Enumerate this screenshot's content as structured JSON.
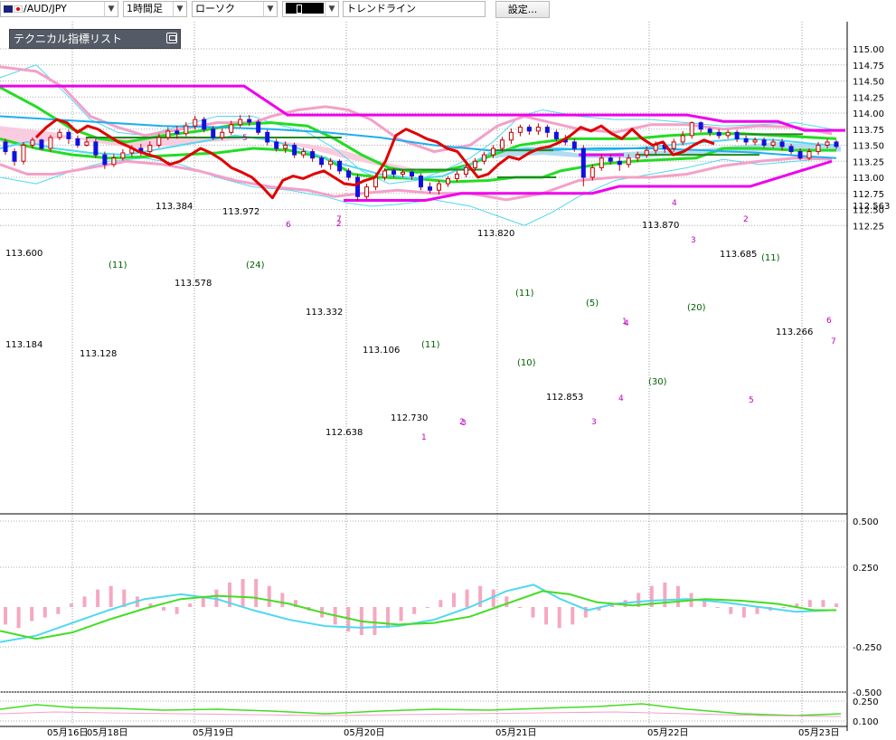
{
  "toolbar": {
    "symbol": "AUD/JPY",
    "timeframe": "1時間足",
    "chart_type": "ローソク",
    "tool": "トレンドライン",
    "settings_label": "設定...",
    "swatch_color": "#000000"
  },
  "indicator_list_title": "テクニカル指標リスト",
  "colors": {
    "bull": "#ffffff",
    "bear": "#1010e0",
    "wick": "#c00000",
    "rsi_line": "#e00000",
    "trendline": "#ee00ee",
    "green_band": "#22dd22",
    "pink_band": "#f4a0c8",
    "cyan_band": "#50d8f0",
    "ma_blue": "#1eaef0",
    "cloud_pink": "#f8c8dc",
    "cloud_blue": "#a8d8f0",
    "macd_hist": "#f6a8c0",
    "level_line": "#228822"
  },
  "chart_data": {
    "type": "candlestick",
    "title": "",
    "price_axis_ticks": [
      "115.00",
      "114.75",
      "114.50",
      "114.25",
      "114.00",
      "113.75",
      "113.50",
      "113.25",
      "113.00",
      "112.75",
      "112.50",
      "112.25"
    ],
    "current_price_label": "112.563",
    "ylim": [
      112.2,
      115.1
    ],
    "x_date_labels": [
      "05月16日",
      "05月18日",
      "05月19日",
      "05月20日",
      "05月21日",
      "05月22日",
      "05月23日"
    ],
    "price_annotations": [
      "113.600",
      "113.184",
      "113.128",
      "113.384",
      "113.578",
      "113.972",
      "113.332",
      "113.106",
      "112.638",
      "112.730",
      "113.820",
      "112.853",
      "113.870",
      "113.685",
      "113.266"
    ],
    "period_labels": [
      "(11)",
      "(24)",
      "(11)",
      "(10)",
      "(11)",
      "(5)",
      "(20)",
      "(30)",
      "(11)"
    ],
    "trendline_numbers": [
      "5",
      "6",
      "7",
      "4",
      "3",
      "2",
      "1",
      "2",
      "3",
      "4",
      "1",
      "5",
      "6",
      "7",
      "2",
      "3",
      "4"
    ],
    "macd_axis_ticks": [
      "0.500",
      "0.250",
      "-0.250",
      "-0.500"
    ],
    "lower_axis_ticks": [
      "0.250",
      "0.100"
    ],
    "candles": [
      [
        113.55,
        113.4,
        113.6,
        113.35
      ],
      [
        113.4,
        113.25,
        113.45,
        113.18
      ],
      [
        113.25,
        113.5,
        113.55,
        113.2
      ],
      [
        113.5,
        113.58,
        113.62,
        113.45
      ],
      [
        113.58,
        113.45,
        113.6,
        113.42
      ],
      [
        113.45,
        113.62,
        113.66,
        113.4
      ],
      [
        113.62,
        113.7,
        113.75,
        113.58
      ],
      [
        113.7,
        113.6,
        113.74,
        113.52
      ],
      [
        113.6,
        113.5,
        113.65,
        113.46
      ],
      [
        113.5,
        113.55,
        113.62,
        113.48
      ],
      [
        113.55,
        113.35,
        113.6,
        113.3
      ],
      [
        113.35,
        113.2,
        113.4,
        113.13
      ],
      [
        113.2,
        113.3,
        113.36,
        113.16
      ],
      [
        113.3,
        113.38,
        113.44,
        113.26
      ],
      [
        113.38,
        113.45,
        113.5,
        113.32
      ],
      [
        113.45,
        113.4,
        113.52,
        113.34
      ],
      [
        113.4,
        113.5,
        113.56,
        113.36
      ],
      [
        113.5,
        113.62,
        113.68,
        113.46
      ],
      [
        113.62,
        113.72,
        113.78,
        113.58
      ],
      [
        113.72,
        113.68,
        113.8,
        113.6
      ],
      [
        113.68,
        113.8,
        113.86,
        113.64
      ],
      [
        113.8,
        113.9,
        113.96,
        113.74
      ],
      [
        113.9,
        113.75,
        113.94,
        113.7
      ],
      [
        113.75,
        113.62,
        113.8,
        113.58
      ],
      [
        113.62,
        113.7,
        113.76,
        113.58
      ],
      [
        113.7,
        113.82,
        113.88,
        113.66
      ],
      [
        113.82,
        113.9,
        113.97,
        113.78
      ],
      [
        113.9,
        113.86,
        113.97,
        113.8
      ],
      [
        113.86,
        113.7,
        113.9,
        113.66
      ],
      [
        113.7,
        113.55,
        113.74,
        113.5
      ],
      [
        113.55,
        113.45,
        113.6,
        113.4
      ],
      [
        113.45,
        113.5,
        113.56,
        113.38
      ],
      [
        113.5,
        113.35,
        113.54,
        113.3
      ],
      [
        113.35,
        113.4,
        113.46,
        113.3
      ],
      [
        113.4,
        113.3,
        113.44,
        113.24
      ],
      [
        113.3,
        113.2,
        113.34,
        113.15
      ],
      [
        113.2,
        113.25,
        113.3,
        113.12
      ],
      [
        113.25,
        113.1,
        113.28,
        113.05
      ],
      [
        113.1,
        113.0,
        113.14,
        112.95
      ],
      [
        113.0,
        112.7,
        113.05,
        112.64
      ],
      [
        112.7,
        112.85,
        112.9,
        112.66
      ],
      [
        112.85,
        113.0,
        113.06,
        112.8
      ],
      [
        113.0,
        113.1,
        113.14,
        112.95
      ],
      [
        113.1,
        113.05,
        113.14,
        113.0
      ],
      [
        113.05,
        113.08,
        113.12,
        113.0
      ],
      [
        113.08,
        113.02,
        113.1,
        112.96
      ],
      [
        113.02,
        112.85,
        113.06,
        112.8
      ],
      [
        112.85,
        112.8,
        112.92,
        112.75
      ],
      [
        112.8,
        112.9,
        112.95,
        112.73
      ],
      [
        112.9,
        112.98,
        113.02,
        112.85
      ],
      [
        112.98,
        113.05,
        113.1,
        112.93
      ],
      [
        113.05,
        113.15,
        113.2,
        113.0
      ],
      [
        113.15,
        113.25,
        113.3,
        113.1
      ],
      [
        113.25,
        113.35,
        113.4,
        113.2
      ],
      [
        113.35,
        113.45,
        113.5,
        113.3
      ],
      [
        113.45,
        113.58,
        113.63,
        113.4
      ],
      [
        113.58,
        113.7,
        113.76,
        113.52
      ],
      [
        113.7,
        113.78,
        113.82,
        113.64
      ],
      [
        113.78,
        113.72,
        113.82,
        113.66
      ],
      [
        113.72,
        113.78,
        113.84,
        113.66
      ],
      [
        113.78,
        113.7,
        113.82,
        113.62
      ],
      [
        113.7,
        113.6,
        113.74,
        113.56
      ],
      [
        113.6,
        113.55,
        113.66,
        113.5
      ],
      [
        113.55,
        113.45,
        113.6,
        113.4
      ],
      [
        113.45,
        113.0,
        113.5,
        112.86
      ],
      [
        113.0,
        113.15,
        113.2,
        112.95
      ],
      [
        113.15,
        113.3,
        113.36,
        113.1
      ],
      [
        113.3,
        113.25,
        113.36,
        113.2
      ],
      [
        113.25,
        113.2,
        113.32,
        113.1
      ],
      [
        113.2,
        113.3,
        113.36,
        113.15
      ],
      [
        113.3,
        113.35,
        113.4,
        113.24
      ],
      [
        113.35,
        113.42,
        113.48,
        113.3
      ],
      [
        113.42,
        113.5,
        113.56,
        113.36
      ],
      [
        113.5,
        113.45,
        113.55,
        113.38
      ],
      [
        113.45,
        113.55,
        113.6,
        113.4
      ],
      [
        113.55,
        113.65,
        113.72,
        113.5
      ],
      [
        113.65,
        113.85,
        113.87,
        113.6
      ],
      [
        113.85,
        113.75,
        113.87,
        113.7
      ],
      [
        113.75,
        113.7,
        113.78,
        113.64
      ],
      [
        113.7,
        113.65,
        113.75,
        113.6
      ],
      [
        113.65,
        113.7,
        113.74,
        113.6
      ],
      [
        113.7,
        113.6,
        113.74,
        113.55
      ],
      [
        113.6,
        113.55,
        113.65,
        113.5
      ],
      [
        113.55,
        113.58,
        113.62,
        113.5
      ],
      [
        113.58,
        113.5,
        113.62,
        113.46
      ],
      [
        113.5,
        113.55,
        113.6,
        113.46
      ],
      [
        113.55,
        113.48,
        113.6,
        113.42
      ],
      [
        113.48,
        113.4,
        113.52,
        113.36
      ],
      [
        113.4,
        113.3,
        113.45,
        113.27
      ],
      [
        113.3,
        113.4,
        113.45,
        113.27
      ],
      [
        113.4,
        113.5,
        113.55,
        113.35
      ],
      [
        113.5,
        113.55,
        113.6,
        113.45
      ],
      [
        113.55,
        113.48,
        113.58,
        113.44
      ]
    ],
    "rsi_like": [
      113.62,
      113.78,
      113.9,
      113.85,
      113.7,
      113.8,
      113.75,
      113.65,
      113.55,
      113.48,
      113.4,
      113.35,
      113.3,
      113.2,
      113.25,
      113.35,
      113.45,
      113.38,
      113.28,
      113.15,
      113.08,
      113.0,
      112.85,
      112.68,
      112.95,
      113.02,
      112.98,
      113.05,
      113.1,
      113.0,
      112.9,
      112.88,
      112.95,
      113.0,
      113.25,
      113.65,
      113.75,
      113.68,
      113.6,
      113.55,
      113.45,
      113.4,
      113.2,
      113.0,
      113.05,
      113.2,
      113.32,
      113.28,
      113.38,
      113.45,
      113.48,
      113.55,
      113.65,
      113.78,
      113.72,
      113.8,
      113.68,
      113.6,
      113.75,
      113.6,
      113.5,
      113.55,
      113.35,
      113.4,
      113.5,
      113.58,
      113.52
    ],
    "macd_hist": [
      -0.05,
      -0.06,
      -0.04,
      -0.03,
      -0.02,
      0.01,
      0.03,
      0.05,
      0.06,
      0.05,
      0.03,
      0.01,
      -0.01,
      -0.02,
      0.01,
      0.03,
      0.05,
      0.07,
      0.08,
      0.08,
      0.06,
      0.04,
      0.02,
      -0.01,
      -0.03,
      -0.05,
      -0.07,
      -0.08,
      -0.08,
      -0.06,
      -0.04,
      -0.02,
      0.0,
      0.02,
      0.04,
      0.05,
      0.06,
      0.05,
      0.03,
      0.0,
      -0.03,
      -0.05,
      -0.06,
      -0.05,
      -0.03,
      -0.01,
      0.01,
      0.02,
      0.04,
      0.06,
      0.07,
      0.06,
      0.04,
      0.02,
      0.0,
      -0.02,
      -0.03,
      -0.02,
      -0.01,
      0.0,
      0.01,
      0.02,
      0.02,
      0.01
    ]
  }
}
